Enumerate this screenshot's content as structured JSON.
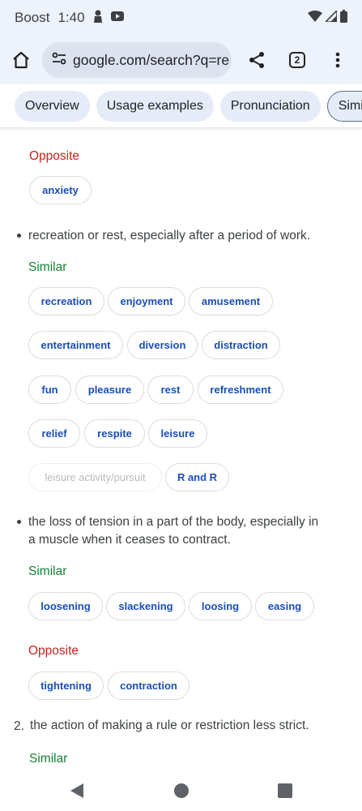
{
  "status": {
    "carrier": "Boost",
    "time": "1:40"
  },
  "browser": {
    "url": "google.com/search?q=re",
    "tab_count": "2"
  },
  "tabs": [
    "Overview",
    "Usage examples",
    "Pronunciation",
    "Simila"
  ],
  "sections": {
    "opposite_label_1": "Opposite",
    "opposite_1": [
      "anxiety"
    ],
    "def_1": "recreation or rest, especially after a period of work.",
    "similar_label_1": "Similar",
    "similar_1_row1": [
      "recreation",
      "enjoyment",
      "amusement"
    ],
    "similar_1_row2": [
      "entertainment",
      "diversion",
      "distraction"
    ],
    "similar_1_row3": [
      "fun",
      "pleasure",
      "rest",
      "refreshment"
    ],
    "similar_1_row4": [
      "relief",
      "respite",
      "leisure"
    ],
    "similar_1_row5": [
      "leisure activity/pursuit",
      "R and R"
    ],
    "def_2_line1": "the loss of tension in a part of the body, especially in",
    "def_2_line2": "a muscle when it ceases to contract.",
    "similar_label_2": "Similar",
    "similar_2": [
      "loosening",
      "slackening",
      "loosing",
      "easing"
    ],
    "opposite_label_2": "Opposite",
    "opposite_2": [
      "tightening",
      "contraction"
    ],
    "def_3_num": "2.",
    "def_3": "the action of making a rule or restriction less strict.",
    "similar_label_3": "Similar"
  }
}
